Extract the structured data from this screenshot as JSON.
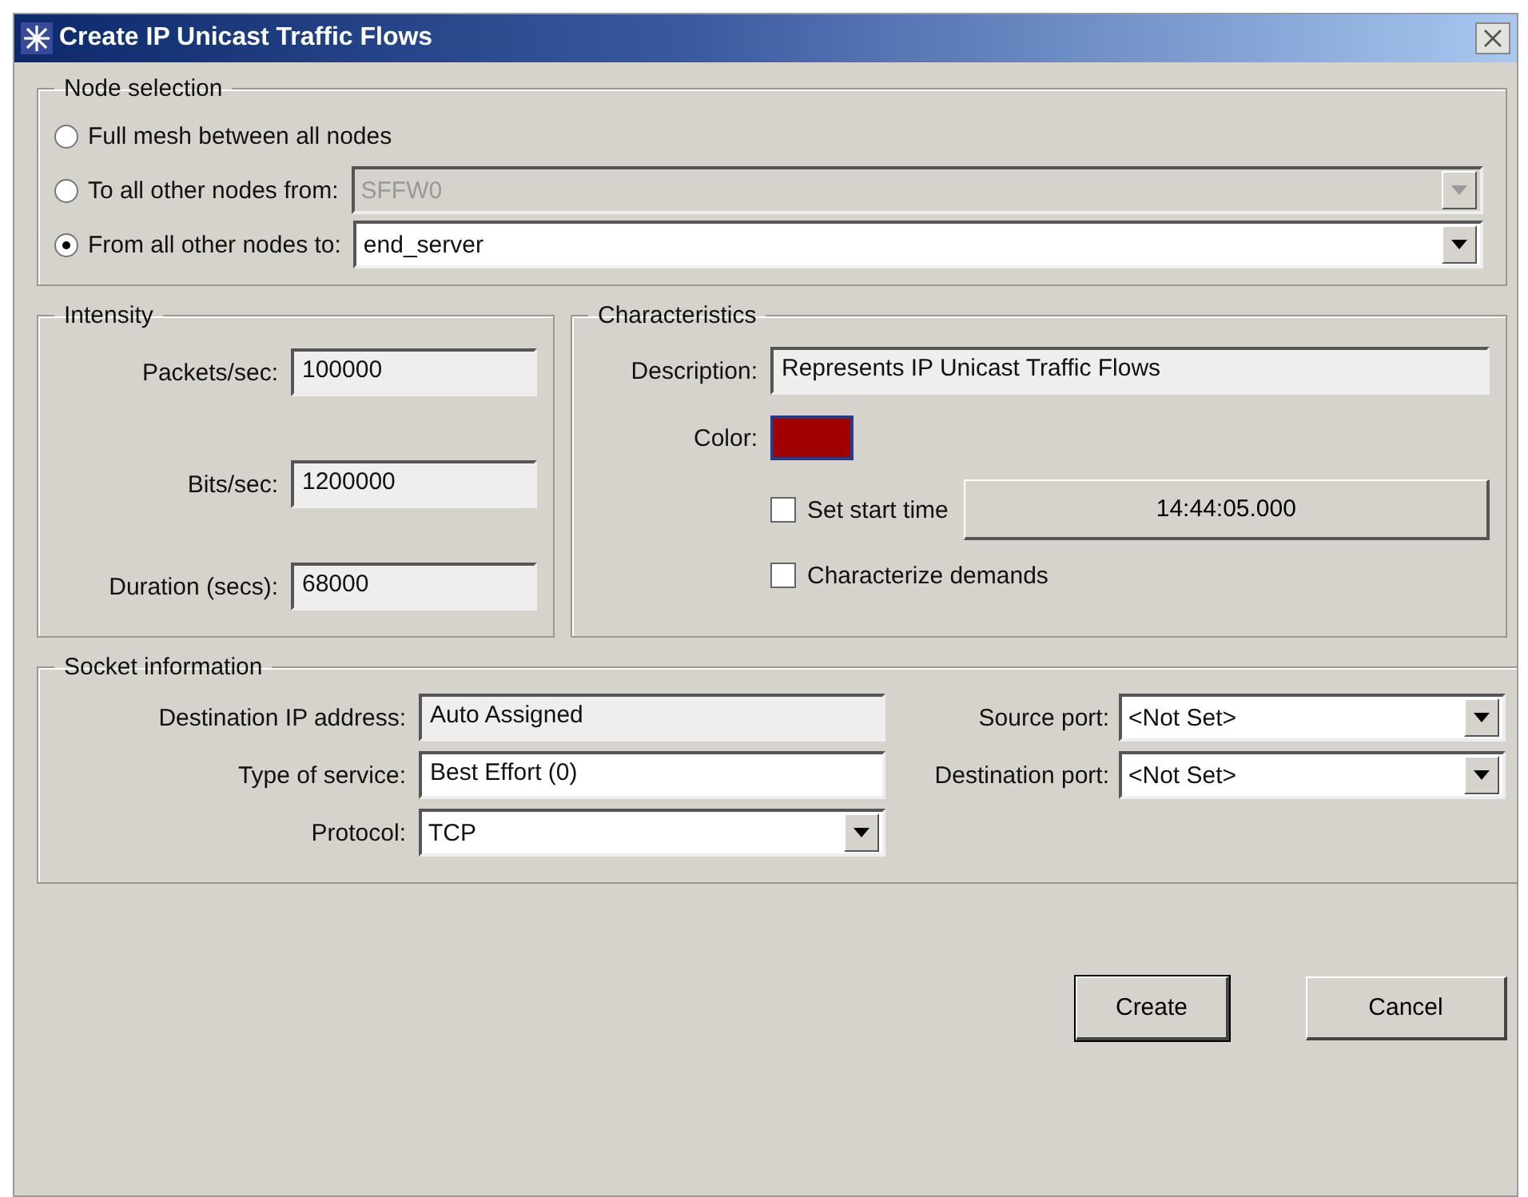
{
  "window": {
    "title": "Create IP Unicast Traffic Flows"
  },
  "node_selection": {
    "title": "Node selection",
    "options": [
      {
        "label": "Full mesh between all nodes",
        "selected": false
      },
      {
        "label": "To all other nodes from:",
        "selected": false,
        "combo": {
          "value": "SFFW0",
          "disabled": true
        }
      },
      {
        "label": "From all other nodes to:",
        "selected": true,
        "combo": {
          "value": "end_server",
          "disabled": false
        }
      }
    ]
  },
  "intensity": {
    "title": "Intensity",
    "fields": [
      {
        "label": "Packets/sec:",
        "value": "100000"
      },
      {
        "label": "Bits/sec:",
        "value": "1200000"
      },
      {
        "label": "Duration (secs):",
        "value": "68000"
      }
    ]
  },
  "characteristics": {
    "title": "Characteristics",
    "description": {
      "label": "Description:",
      "value": "Represents IP Unicast Traffic Flows"
    },
    "color": {
      "label": "Color:",
      "color": "#a00000"
    },
    "set_start_time": {
      "label": "Set start time",
      "checked": false,
      "time": "14:44:05.000"
    },
    "characterize_demands": {
      "label": "Characterize demands",
      "checked": false
    }
  },
  "socket": {
    "title": "Socket information",
    "left": [
      {
        "label": "Destination IP address:",
        "value": "Auto Assigned",
        "kind": "readonly"
      },
      {
        "label": "Type of service:",
        "value": "Best Effort (0)",
        "kind": "text"
      },
      {
        "label": "Protocol:",
        "value": "TCP",
        "kind": "combo"
      }
    ],
    "right": [
      {
        "label": "Source port:",
        "value": "<Not Set>",
        "kind": "combo"
      },
      {
        "label": "Destination port:",
        "value": "<Not Set>",
        "kind": "combo"
      }
    ]
  },
  "buttons": [
    {
      "label": "Create",
      "default": true
    },
    {
      "label": "Cancel",
      "default": false
    }
  ]
}
